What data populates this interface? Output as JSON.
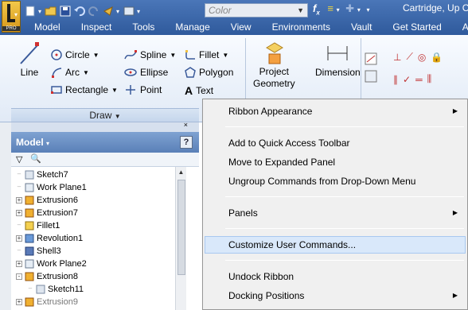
{
  "qat": {
    "color_placeholder": "Color",
    "fx": "f",
    "fx_sub": "x"
  },
  "title": "Cartridge, Up C",
  "app_button": {
    "badge": "PRO"
  },
  "tabs": [
    "Model",
    "Inspect",
    "Tools",
    "Manage",
    "View",
    "Environments",
    "Vault",
    "Get Started",
    "Add-I"
  ],
  "ribbon": {
    "line": "Line",
    "circle": "Circle",
    "arc": "Arc",
    "rectangle": "Rectangle",
    "spline": "Spline",
    "ellipse": "Ellipse",
    "point": "Point",
    "fillet": "Fillet",
    "polygon": "Polygon",
    "text": "Text",
    "project_geometry": [
      "Project",
      "Geometry"
    ],
    "dimension": "Dimension",
    "draw_panel": "Draw"
  },
  "browser": {
    "title": "Model",
    "help": "?",
    "items": [
      {
        "label": "Sketch7",
        "icon": "sketch-icon",
        "expand": ""
      },
      {
        "label": "Work Plane1",
        "icon": "work-plane-icon",
        "expand": ""
      },
      {
        "label": "Extrusion6",
        "icon": "extrusion-icon",
        "expand": "+"
      },
      {
        "label": "Extrusion7",
        "icon": "extrusion-icon",
        "expand": "+"
      },
      {
        "label": "Fillet1",
        "icon": "fillet-icon",
        "expand": ""
      },
      {
        "label": "Revolution1",
        "icon": "revolution-icon",
        "expand": "+"
      },
      {
        "label": "Shell3",
        "icon": "shell-icon",
        "expand": ""
      },
      {
        "label": "Work Plane2",
        "icon": "work-plane-icon",
        "expand": "+"
      },
      {
        "label": "Extrusion8",
        "icon": "extrusion-icon",
        "expand": "-"
      },
      {
        "label": "Sketch11",
        "icon": "sketch-icon",
        "expand": ""
      },
      {
        "label": "Extrusion9",
        "icon": "extrusion-icon",
        "expand": "+"
      }
    ]
  },
  "context_menu": {
    "items": [
      {
        "label": "Ribbon Appearance",
        "submenu": true
      },
      {
        "label": "Add to Quick Access Toolbar",
        "submenu": false
      },
      {
        "label": "Move to Expanded Panel",
        "submenu": false
      },
      {
        "label": "Ungroup Commands from Drop-Down Menu",
        "submenu": false
      },
      {
        "label": "Panels",
        "submenu": true
      },
      {
        "label": "Customize User Commands...",
        "submenu": false,
        "highlighted": true
      },
      {
        "label": "Undock Ribbon",
        "submenu": false
      },
      {
        "label": "Docking Positions",
        "submenu": true
      }
    ]
  },
  "colors": {
    "titlebar": "#3a66a8",
    "menu_highlight": "#d9e8fa",
    "ribbon_bg": "#eef3fa"
  }
}
